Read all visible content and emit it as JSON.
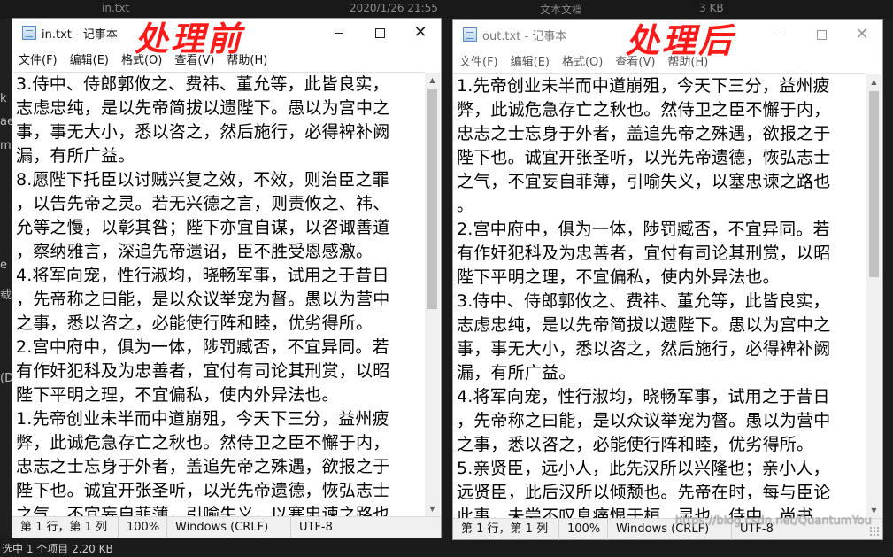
{
  "left_window": {
    "title": "in.txt - 记事本",
    "overlay": "处理前",
    "menu": [
      "文件(F)",
      "编辑(E)",
      "格式(O)",
      "查看(V)",
      "帮助(H)"
    ],
    "lines": [
      "3.侍中、侍郎郭攸之、费祎、董允等，此皆良实，",
      "志虑忠纯，是以先帝简拔以遗陛下。愚以为宫中之",
      "事，事无大小，悉以咨之，然后施行，必得裨补阙",
      "漏，有所广益。",
      "8.愿陛下托臣以讨贼兴复之效，不效，则治臣之罪",
      "，以告先帝之灵。若无兴德之言，则责攸之、祎、",
      "允等之慢，以彰其咎；陛下亦宜自谋，以咨诹善道",
      "，察纳雅言，深追先帝遗诏，臣不胜受恩感激。",
      "4.将军向宠，性行淑均，晓畅军事，试用之于昔日",
      "，先帝称之曰能，是以众议举宠为督。愚以为营中",
      "之事，悉以咨之，必能使行阵和睦，优劣得所。",
      "2.宫中府中，俱为一体，陟罚臧否，不宜异同。若",
      "有作奸犯科及为忠善者，宜付有司论其刑赏，以昭",
      "陛下平明之理，不宜偏私，使内外异法也。",
      "1.先帝创业未半而中道崩殂，今天下三分，益州疲",
      "弊，此诚危急存亡之秋也。然侍卫之臣不懈于内，",
      "忠志之士忘身于外者，盖追先帝之殊遇，欲报之于",
      "陛下也。诚宜开张圣听，以光先帝遗德，恢弘志士",
      "之气，不宜妄自菲薄，引喻失义，以塞忠谏之路也"
    ],
    "status": {
      "position": "第 1 行，第 1 列",
      "zoom": "100%",
      "eol": "Windows (CRLF)",
      "encoding": "UTF-8"
    }
  },
  "right_window": {
    "title": "out.txt - 记事本",
    "overlay": "处理后",
    "menu": [
      "文件(F)",
      "编辑(E)",
      "格式(O)",
      "查看(V)",
      "帮助(H)"
    ],
    "lines": [
      "1.先帝创业未半而中道崩殂，今天下三分，益州疲",
      "弊，此诚危急存亡之秋也。然侍卫之臣不懈于内，",
      "忠志之士忘身于外者，盖追先帝之殊遇，欲报之于",
      "陛下也。诚宜开张圣听，以光先帝遗德，恢弘志士",
      "之气，不宜妄自菲薄，引喻失义，以塞忠谏之路也",
      "。",
      "2.宫中府中，俱为一体，陟罚臧否，不宜异同。若",
      "有作奸犯科及为忠善者，宜付有司论其刑赏，以昭",
      "陛下平明之理，不宜偏私，使内外异法也。",
      "3.侍中、侍郎郭攸之、费祎、董允等，此皆良实，",
      "志虑忠纯，是以先帝简拔以遗陛下。愚以为宫中之",
      "事，事无大小，悉以咨之，然后施行，必得裨补阙",
      "漏，有所广益。",
      "4.将军向宠，性行淑均，晓畅军事，试用之于昔日",
      "，先帝称之曰能，是以众议举宠为督。愚以为营中",
      "之事，悉以咨之，必能使行阵和睦，优劣得所。",
      "5.亲贤臣，远小人，此先汉所以兴隆也；亲小人，",
      "远贤臣，此后汉所以倾颓也。先帝在时，每与臣论",
      "此事，未尝不叹息痛恨于桓、灵也。侍中、尚书"
    ],
    "status": {
      "position": "第 1 行，第 1 列",
      "zoom": "100%",
      "eol": "Windows (CRLF)",
      "encoding": "UTF-8"
    },
    "watermark": "https://blog.csdn.net/QuantumYou"
  },
  "background": {
    "top_file_name": "in.txt",
    "top_date": "2020/1/26 21:55",
    "top_type": "文本文档",
    "top_size": "3 KB",
    "bottom_status": "选中 1 个项目  2.20 KB",
    "left_labels": [
      "k",
      "ae",
      "m",
      "e",
      "载",
      "(D"
    ]
  }
}
